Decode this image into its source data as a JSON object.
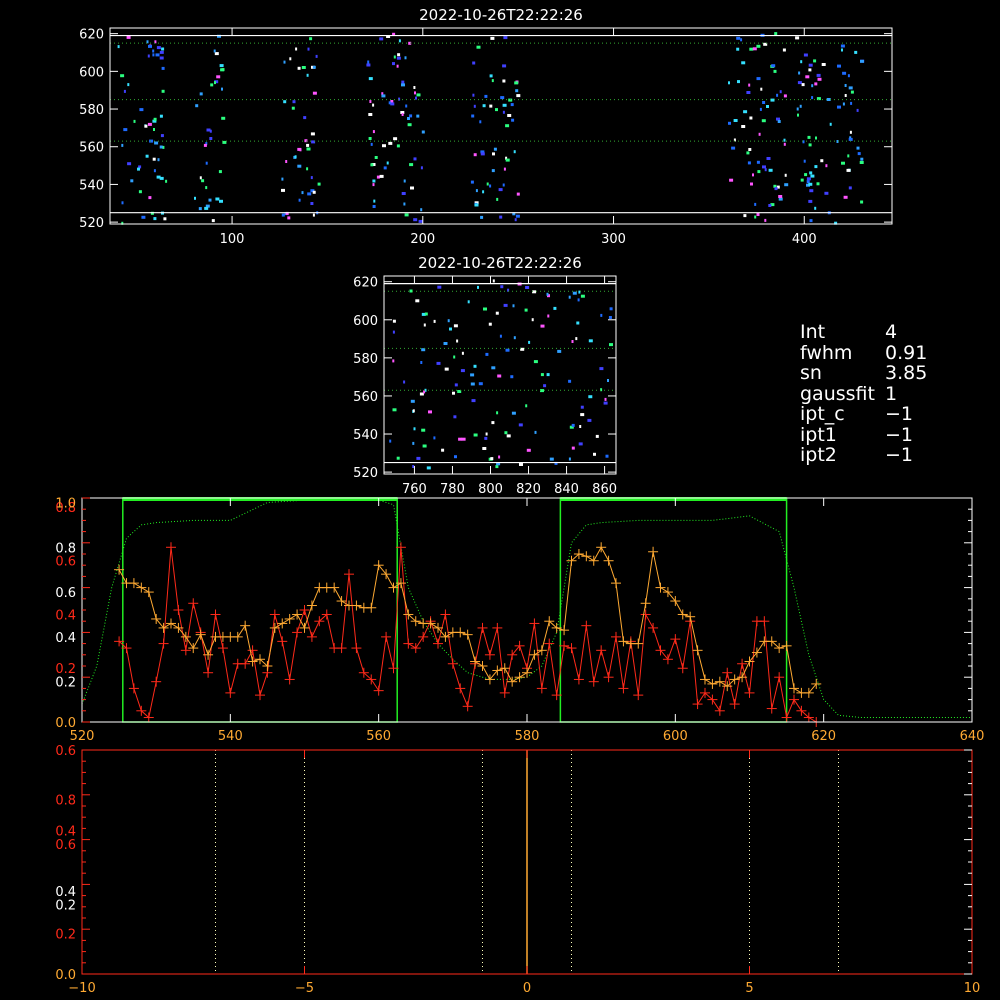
{
  "colors": {
    "background": "#000000",
    "axis": "#ffffff",
    "red": "#ff2a1a",
    "orange": "#ffaa33",
    "green": "#22ee22",
    "dotted": "#33aa33",
    "pale": "#ffffbb"
  },
  "info": [
    {
      "key": "Int",
      "value": "4"
    },
    {
      "key": "fwhm",
      "value": "0.91"
    },
    {
      "key": "sn",
      "value": "3.85"
    },
    {
      "key": "gaussfit",
      "value": "1"
    },
    {
      "key": "ipt_c",
      "value": "−1"
    },
    {
      "key": "ipt1",
      "value": "−1"
    },
    {
      "key": "ipt2",
      "value": "−1"
    }
  ],
  "chart_data": [
    {
      "type": "heatmap",
      "title": "2022-10-26T22:22:26",
      "xlim": [
        36,
        446
      ],
      "ylim": [
        519,
        623
      ],
      "xticks": [
        "100",
        "200",
        "300",
        "400"
      ],
      "xtick_values": [
        100,
        200,
        300,
        400
      ],
      "yticks": [
        "520",
        "540",
        "560",
        "580",
        "600",
        "620"
      ],
      "ytick_values": [
        520,
        540,
        560,
        580,
        600,
        620
      ],
      "white_lines": [
        525,
        619
      ],
      "dotted_lines": [
        563,
        585,
        615
      ],
      "pixel_columns": [
        [
          40,
          65
        ],
        [
          80,
          95
        ],
        [
          125,
          145
        ],
        [
          170,
          200
        ],
        [
          225,
          250
        ],
        [
          360,
          390
        ],
        [
          395,
          430
        ]
      ]
    },
    {
      "type": "heatmap",
      "title": "2022-10-26T22:22:26",
      "xlim": [
        744,
        866
      ],
      "ylim": [
        519,
        623
      ],
      "xticks": [
        "760",
        "780",
        "800",
        "820",
        "840",
        "860"
      ],
      "xtick_values": [
        760,
        780,
        800,
        820,
        840,
        860
      ],
      "yticks": [
        "520",
        "540",
        "560",
        "580",
        "600",
        "620"
      ],
      "ytick_values": [
        520,
        540,
        560,
        580,
        600,
        620
      ],
      "white_lines": [
        525,
        619
      ],
      "dotted_lines": [
        563,
        585,
        615
      ],
      "pixel_columns": [
        [
          746,
          864
        ]
      ]
    },
    {
      "type": "line",
      "xlim": [
        520,
        640
      ],
      "ylim": [
        0,
        1
      ],
      "xticks": [
        "520",
        "540",
        "560",
        "580",
        "600",
        "620",
        "640"
      ],
      "xtick_values": [
        520,
        540,
        560,
        580,
        600,
        620,
        640
      ],
      "left_ticks": [
        {
          "v": 0.0,
          "t": "0.0",
          "c": "#ffaa33"
        },
        {
          "v": 0.18,
          "t": "0.2",
          "c": "#ffffff"
        },
        {
          "v": 0.24,
          "t": "0.2",
          "c": "#ff2a1a"
        },
        {
          "v": 0.38,
          "t": "0.4",
          "c": "#ffffff"
        },
        {
          "v": 0.48,
          "t": "0.4",
          "c": "#ff2a1a"
        },
        {
          "v": 0.58,
          "t": "0.6",
          "c": "#ffffff"
        },
        {
          "v": 0.72,
          "t": "0.6",
          "c": "#ff2a1a"
        },
        {
          "v": 0.78,
          "t": "0.8",
          "c": "#ffffff"
        },
        {
          "v": 0.96,
          "t": "0.8",
          "c": "#ff2a1a"
        },
        {
          "v": 0.98,
          "t": "1.0",
          "c": "#ffaa33"
        }
      ],
      "green_boxes": [
        [
          525.5,
          562.5
        ],
        [
          584.5,
          615
        ]
      ],
      "series": [
        {
          "color": "#22ee22",
          "style": "dotted",
          "x": [
            520,
            522,
            524,
            526,
            528,
            530,
            535,
            540,
            545,
            550,
            555,
            560,
            562,
            564,
            566,
            568,
            570,
            572,
            575,
            578,
            580,
            582,
            584,
            586,
            588,
            590,
            595,
            600,
            605,
            610,
            614,
            616,
            618,
            620,
            622,
            625,
            630,
            635,
            640
          ],
          "y": [
            0.08,
            0.25,
            0.6,
            0.82,
            0.88,
            0.89,
            0.9,
            0.9,
            0.98,
            0.99,
            0.99,
            0.99,
            0.97,
            0.6,
            0.45,
            0.35,
            0.28,
            0.22,
            0.19,
            0.19,
            0.2,
            0.25,
            0.4,
            0.8,
            0.88,
            0.89,
            0.9,
            0.9,
            0.9,
            0.92,
            0.85,
            0.6,
            0.3,
            0.1,
            0.03,
            0.02,
            0.02,
            0.02,
            0.02
          ]
        },
        {
          "color": "#ff2a1a",
          "style": "solid",
          "x": [
            525,
            526,
            527,
            528,
            529,
            530,
            531,
            532,
            533,
            534,
            535,
            536,
            537,
            538,
            539,
            540,
            541,
            542,
            543,
            544,
            545,
            546,
            547,
            548,
            549,
            550,
            551,
            552,
            553,
            554,
            555,
            556,
            557,
            558,
            559,
            560,
            561,
            562,
            563,
            564,
            565,
            566,
            567,
            568,
            569,
            570,
            571,
            572,
            573,
            574,
            575,
            576,
            577,
            578,
            579,
            580,
            581,
            582,
            583,
            584,
            585,
            586,
            587,
            588,
            589,
            590,
            591,
            592,
            593,
            594,
            595,
            596,
            597,
            598,
            599,
            600,
            601,
            602,
            603,
            604,
            605,
            606,
            607,
            608,
            609,
            610,
            611,
            612,
            613,
            614,
            615,
            616,
            617,
            618,
            619
          ],
          "y": [
            0.36,
            0.33,
            0.15,
            0.05,
            0.02,
            0.18,
            0.35,
            0.78,
            0.5,
            0.32,
            0.53,
            0.4,
            0.22,
            0.48,
            0.33,
            0.13,
            0.26,
            0.26,
            0.32,
            0.12,
            0.22,
            0.48,
            0.36,
            0.19,
            0.4,
            0.5,
            0.38,
            0.45,
            0.48,
            0.33,
            0.33,
            0.66,
            0.33,
            0.22,
            0.19,
            0.14,
            0.38,
            0.24,
            0.78,
            0.35,
            0.33,
            0.38,
            0.45,
            0.35,
            0.48,
            0.26,
            0.15,
            0.07,
            0.26,
            0.42,
            0.3,
            0.42,
            0.13,
            0.3,
            0.34,
            0.24,
            0.44,
            0.15,
            0.35,
            0.12,
            0.34,
            0.33,
            0.19,
            0.43,
            0.18,
            0.32,
            0.2,
            0.38,
            0.15,
            0.36,
            0.12,
            0.48,
            0.42,
            0.32,
            0.28,
            0.37,
            0.24,
            0.45,
            0.08,
            0.13,
            0.1,
            0.05,
            0.22,
            0.08,
            0.26,
            0.13,
            0.45,
            0.45,
            0.06,
            0.2,
            0.02,
            0.1,
            0.05,
            0.02,
            0.0
          ]
        },
        {
          "color": "#ffaa33",
          "style": "solid",
          "x": [
            525,
            526,
            527,
            528,
            529,
            530,
            531,
            532,
            533,
            534,
            535,
            536,
            537,
            538,
            539,
            540,
            541,
            542,
            543,
            544,
            545,
            546,
            547,
            548,
            549,
            550,
            551,
            552,
            553,
            554,
            555,
            556,
            557,
            558,
            559,
            560,
            561,
            562,
            563,
            564,
            565,
            566,
            567,
            568,
            569,
            570,
            571,
            572,
            573,
            574,
            575,
            576,
            577,
            578,
            579,
            580,
            581,
            582,
            583,
            584,
            585,
            586,
            587,
            588,
            589,
            590,
            591,
            592,
            593,
            594,
            595,
            596,
            597,
            598,
            599,
            600,
            601,
            602,
            603,
            604,
            605,
            606,
            607,
            608,
            609,
            610,
            611,
            612,
            613,
            614,
            615,
            616,
            617,
            618,
            619
          ],
          "y": [
            0.68,
            0.62,
            0.62,
            0.6,
            0.58,
            0.46,
            0.42,
            0.44,
            0.42,
            0.38,
            0.33,
            0.39,
            0.3,
            0.38,
            0.38,
            0.38,
            0.38,
            0.43,
            0.27,
            0.28,
            0.25,
            0.42,
            0.44,
            0.46,
            0.48,
            0.42,
            0.52,
            0.6,
            0.6,
            0.6,
            0.54,
            0.52,
            0.52,
            0.51,
            0.51,
            0.7,
            0.66,
            0.6,
            0.62,
            0.48,
            0.45,
            0.44,
            0.44,
            0.42,
            0.38,
            0.4,
            0.4,
            0.39,
            0.27,
            0.25,
            0.19,
            0.23,
            0.24,
            0.18,
            0.2,
            0.22,
            0.3,
            0.32,
            0.45,
            0.42,
            0.41,
            0.72,
            0.75,
            0.74,
            0.72,
            0.78,
            0.72,
            0.62,
            0.36,
            0.35,
            0.35,
            0.53,
            0.76,
            0.6,
            0.58,
            0.54,
            0.48,
            0.47,
            0.32,
            0.19,
            0.17,
            0.18,
            0.16,
            0.19,
            0.2,
            0.27,
            0.31,
            0.36,
            0.36,
            0.33,
            0.34,
            0.15,
            0.13,
            0.13,
            0.17
          ]
        }
      ],
      "crosshatch": {
        "note": "plus markers on red and orange series"
      }
    },
    {
      "type": "line",
      "xlim": [
        -10,
        10
      ],
      "ylim": [
        0,
        1
      ],
      "xticks": [
        "−10",
        "−5",
        "0",
        "5",
        "10"
      ],
      "xtick_values": [
        -10,
        -5,
        0,
        5,
        10
      ],
      "left_ticks": [
        {
          "v": 0.0,
          "t": "0.0",
          "c": "#ffaa33"
        },
        {
          "v": 0.18,
          "t": "0.2",
          "c": "#ff2a1a"
        },
        {
          "v": 0.31,
          "t": "0.2",
          "c": "#ffffff"
        },
        {
          "v": 0.37,
          "t": "0.4",
          "c": "#ffffff"
        },
        {
          "v": 0.58,
          "t": "0.6",
          "c": "#ff2a1a"
        },
        {
          "v": 0.64,
          "t": "0.4",
          "c": "#ff2a1a"
        },
        {
          "v": 0.78,
          "t": "0.8",
          "c": "#ff2a1a"
        },
        {
          "v": 1.0,
          "t": "0.6",
          "c": "#ff2a1a"
        }
      ],
      "vlines_pale": [
        -7,
        -5,
        -1,
        1,
        5,
        7
      ],
      "vline_orange": 0
    }
  ]
}
